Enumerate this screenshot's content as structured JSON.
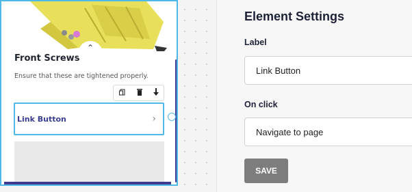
{
  "preview": {
    "title": "Front Screws",
    "description": "Ensure that these are tightened properly.",
    "toolbar": {
      "copy_icon": "copy-icon",
      "delete_icon": "trash-icon",
      "move_icon": "arrow-down-icon"
    },
    "link_button_label": "Link Button",
    "chevron_up": "⌃",
    "arrow_right": "›"
  },
  "settings": {
    "heading": "Element Settings",
    "label_field_title": "Label",
    "label_value": "Link Button",
    "onclick_title": "On click",
    "onclick_value": "Navigate to page",
    "save_label": "SAVE"
  },
  "colors": {
    "selection": "#4fb8e8",
    "accent": "#3f3a8f",
    "save_button": "#7d7d7d"
  }
}
